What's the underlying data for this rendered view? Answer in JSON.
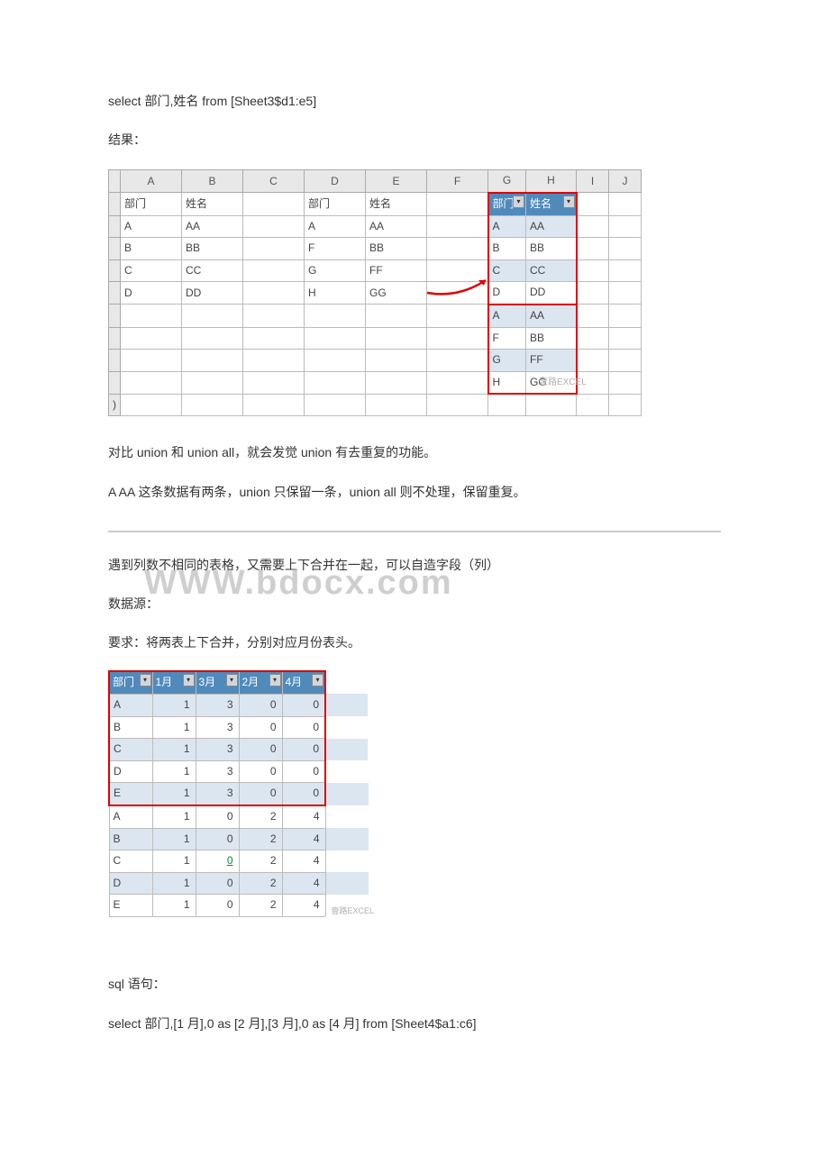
{
  "text": {
    "sql1": "select 部门,姓名 from [Sheet3$d1:e5]",
    "result_label": "结果：",
    "compare": "对比 union 和 union all，就会发觉 union 有去重复的功能。",
    "a_aa": "A  AA 这条数据有两条，union 只保留一条，union all 则不处理，保留重复。",
    "diff_cols": "遇到列数不相同的表格，又需要上下合并在一起，可以自造字段（列）",
    "datasource": "数据源：",
    "requirement": "要求：将两表上下合并，分别对应月份表头。",
    "sql_label": "sql 语句：",
    "sql2": "select 部门,[1 月],0 as [2 月],[3 月],0 as [4 月] from [Sheet4$a1:c6]",
    "watermark_big": "WWW.bdocx.com",
    "watermark_small": "壹路EXCEL",
    "watermark_small2": "壹路EXCEL"
  },
  "sheet1": {
    "colheads": [
      "A",
      "B",
      "C",
      "D",
      "E",
      "F",
      "G",
      "H",
      "I",
      "J"
    ],
    "left": {
      "header": [
        "部门",
        "姓名"
      ],
      "rows": [
        [
          "A",
          "AA"
        ],
        [
          "B",
          "BB"
        ],
        [
          "C",
          "CC"
        ],
        [
          "D",
          "DD"
        ]
      ]
    },
    "mid": {
      "header": [
        "部门",
        "姓名"
      ],
      "rows": [
        [
          "A",
          "AA"
        ],
        [
          "F",
          "BB"
        ],
        [
          "G",
          "FF"
        ],
        [
          "H",
          "GG"
        ]
      ]
    },
    "right": {
      "header": [
        "部门",
        "姓名"
      ],
      "rows": [
        [
          "A",
          "AA"
        ],
        [
          "B",
          "BB"
        ],
        [
          "C",
          "CC"
        ],
        [
          "D",
          "DD"
        ],
        [
          "A",
          "AA"
        ],
        [
          "F",
          "BB"
        ],
        [
          "G",
          "FF"
        ],
        [
          "H",
          "GG"
        ]
      ]
    }
  },
  "sheet2": {
    "header": [
      "部门",
      "1月",
      "3月",
      "2月",
      "4月"
    ],
    "rows": [
      [
        "A",
        "1",
        "3",
        "0",
        "0"
      ],
      [
        "B",
        "1",
        "3",
        "0",
        "0"
      ],
      [
        "C",
        "1",
        "3",
        "0",
        "0"
      ],
      [
        "D",
        "1",
        "3",
        "0",
        "0"
      ],
      [
        "E",
        "1",
        "3",
        "0",
        "0"
      ],
      [
        "A",
        "1",
        "0",
        "2",
        "4"
      ],
      [
        "B",
        "1",
        "0",
        "2",
        "4"
      ],
      [
        "C",
        "1",
        "0",
        "2",
        "4"
      ],
      [
        "D",
        "1",
        "0",
        "2",
        "4"
      ],
      [
        "E",
        "1",
        "0",
        "2",
        "4"
      ]
    ]
  }
}
